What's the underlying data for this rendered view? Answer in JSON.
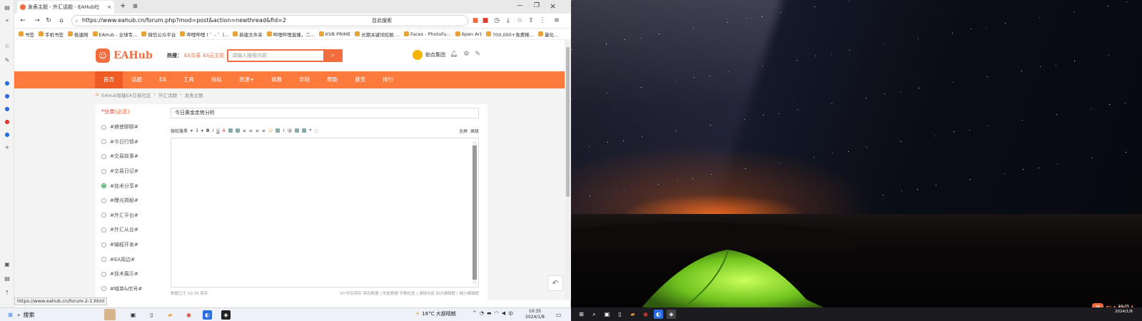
{
  "browser": {
    "tab_title": "发表主题 - 外汇话题 - EAHub社",
    "url": "https://www.eahub.cn/forum.php?mod=post&action=newthread&fid=2",
    "search_engine_label": "百此搜索",
    "status_url": "https://www.eahub.cn/forum-2-1.html"
  },
  "bookmarks": [
    "书签",
    "手机书签",
    "极速网",
    "EAHub - 全球专...",
    "微信公众平台",
    "哔哩哔哩 ( ゜- ゜)...",
    "新建文件夹",
    "哔哩哔哩直播，二...",
    "KVB PRIME",
    "长期关键词挖掘 ...",
    "Faces - PhotoFu...",
    "6pen Art",
    "700,000+免费稀...",
    "量化..."
  ],
  "site": {
    "logo_text": "EAHub",
    "hot_label": "热搜：",
    "hot_links": [
      "EA交易",
      "EA云主机"
    ],
    "search_placeholder": "请输入搜索内容",
    "user_name": "助合集团",
    "nav": [
      "首页",
      "话题",
      "EA",
      "工具",
      "指标",
      "资源+",
      "商教",
      "学院",
      "帮助",
      "悬赏",
      "排行"
    ],
    "breadcrumb": [
      "EAHub智能EA交易社区",
      "›",
      "外汇话题",
      "›",
      "发表主题"
    ]
  },
  "category": {
    "title": "*分类",
    "required": "(必选)",
    "items": [
      "#搞使聊聊#",
      "#今日行情#",
      "#交易故事#",
      "#交易日记#",
      "#技术分享#",
      "#曝光揭秘#",
      "#外汇平台#",
      "#外汇从业#",
      "#编程开发#",
      "#EA周边#",
      "#技术展示#",
      "#喊单&信号#"
    ],
    "selected": 4
  },
  "editor": {
    "subject": "今日黄金走势分析",
    "font": "微软雅黑",
    "size": "3",
    "tool_right": [
      "全屏",
      "高级"
    ],
    "foot_left": "数据已于 10:35 保存",
    "foot_right": "30 秒后保存  保存数据 | 恢复数据   字数检查 | 清除内容   加大编辑框 | 缩小编辑框"
  },
  "taskbar": {
    "search": "搜索",
    "weather": "16°C  大部晴朗",
    "ime": "中",
    "time": "10:35",
    "date": "2024/1/8"
  },
  "wallpaper": {
    "logo": "EAHub",
    "time": "10:35",
    "date": "2024/1/8"
  }
}
